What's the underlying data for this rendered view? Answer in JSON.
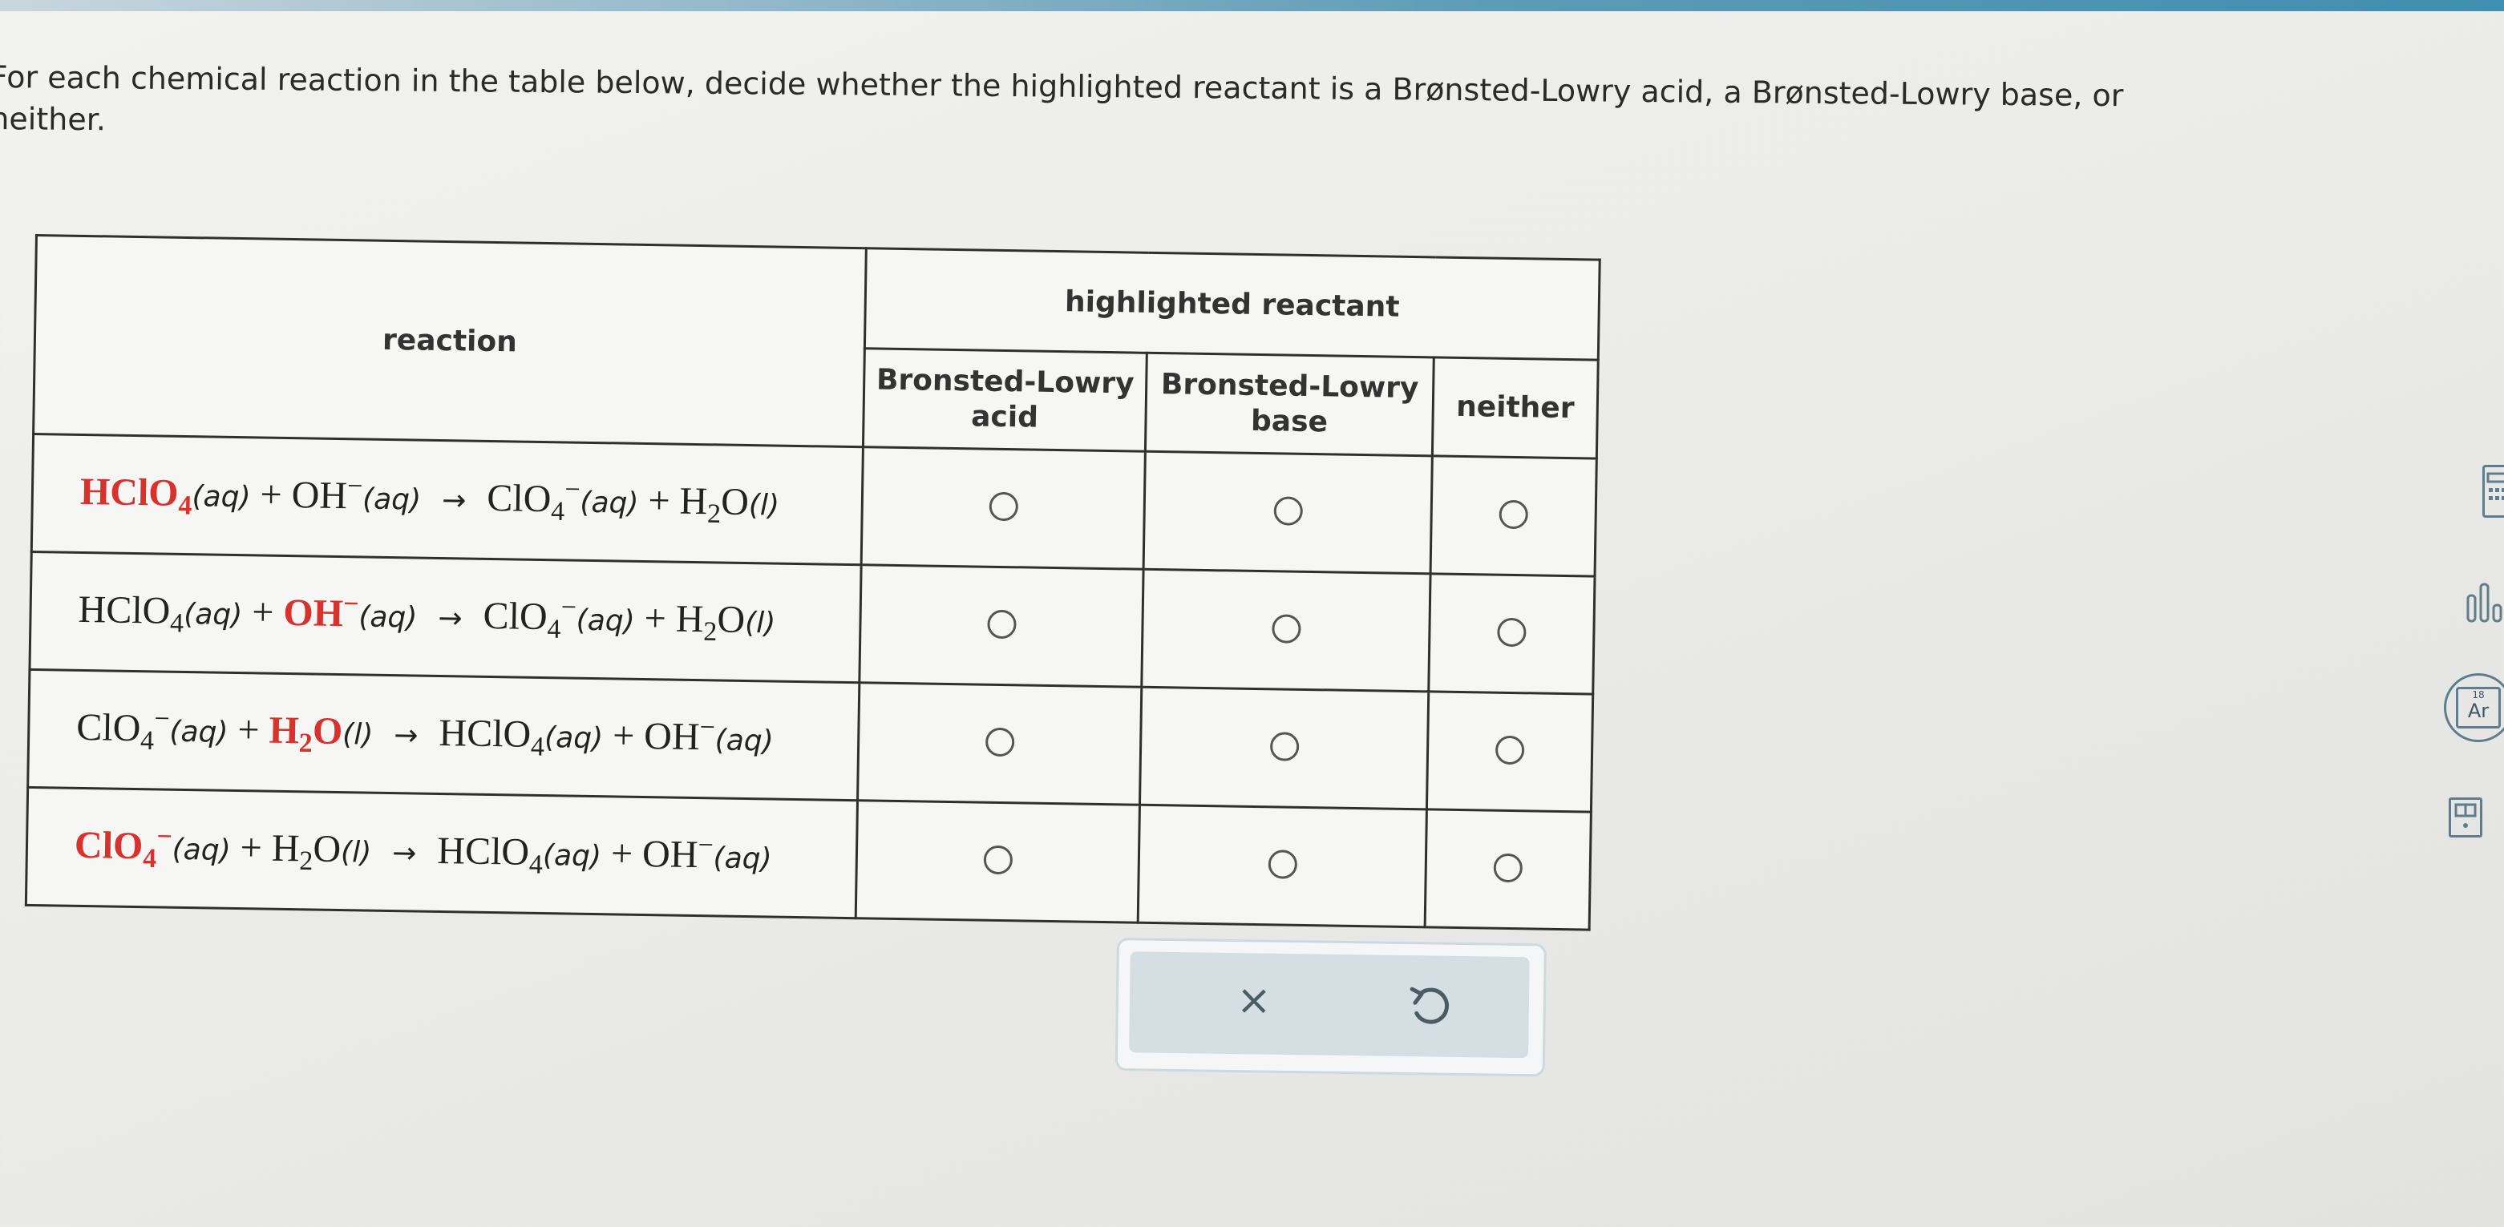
{
  "prompt": {
    "line1": "For each chemical reaction in the table below, decide whether the highlighted reactant is a Brønsted-Lowry acid, a Brønsted-Lowry base, or",
    "line2": "neither."
  },
  "table": {
    "col_reaction": "reaction",
    "col_group": "highlighted reactant",
    "col_acid": "Bronsted-Lowry acid",
    "col_base": "Bronsted-Lowry base",
    "col_neither": "neither",
    "rows": [
      {
        "highlighted": "HClO4",
        "selected": null,
        "t": {
          "a": "HClO",
          "a_sub": "4",
          "a_state": "(aq)",
          "plus1": "+",
          "b": "OH",
          "b_sup": "−",
          "b_state": "(aq)",
          "arrow": "→",
          "c": "ClO",
          "c_sub": "4",
          "c_sup": "−",
          "c_state": "(aq)",
          "plus2": "+",
          "d": "H",
          "d_sub": "2",
          "d2": "O",
          "d_state": "(l)"
        }
      },
      {
        "highlighted": "OH-",
        "selected": null,
        "t": {
          "a": "HClO",
          "a_sub": "4",
          "a_state": "(aq)",
          "plus1": "+",
          "b": "OH",
          "b_sup": "−",
          "b_state": "(aq)",
          "arrow": "→",
          "c": "ClO",
          "c_sub": "4",
          "c_sup": "−",
          "c_state": "(aq)",
          "plus2": "+",
          "d": "H",
          "d_sub": "2",
          "d2": "O",
          "d_state": "(l)"
        }
      },
      {
        "highlighted": "H2O",
        "selected": null,
        "t": {
          "a": "ClO",
          "a_sub": "4",
          "a_sup": "−",
          "a_state": "(aq)",
          "plus1": "+",
          "b": "H",
          "b_sub": "2",
          "b2": "O",
          "b_state": "(l)",
          "arrow": "→",
          "c": "HClO",
          "c_sub": "4",
          "c_state": "(aq)",
          "plus2": "+",
          "d": "OH",
          "d_sup": "−",
          "d_state": "(aq)"
        }
      },
      {
        "highlighted": "ClO4-",
        "selected": null,
        "t": {
          "a": "ClO",
          "a_sub": "4",
          "a_sup": "−",
          "a_state": "(aq)",
          "plus1": "+",
          "b": "H",
          "b_sub": "2",
          "b2": "O",
          "b_state": "(l)",
          "arrow": "→",
          "c": "HClO",
          "c_sub": "4",
          "c_state": "(aq)",
          "plus2": "+",
          "d": "OH",
          "d_sup": "−",
          "d_state": "(aq)"
        }
      }
    ]
  },
  "actions": {
    "clear_icon": "×",
    "undo_icon": "undo-icon"
  },
  "sidebar": {
    "periodic_number": "18",
    "periodic_symbol": "Ar"
  },
  "colors": {
    "highlight": "#d8322e",
    "accent": "#3f8fb0"
  }
}
